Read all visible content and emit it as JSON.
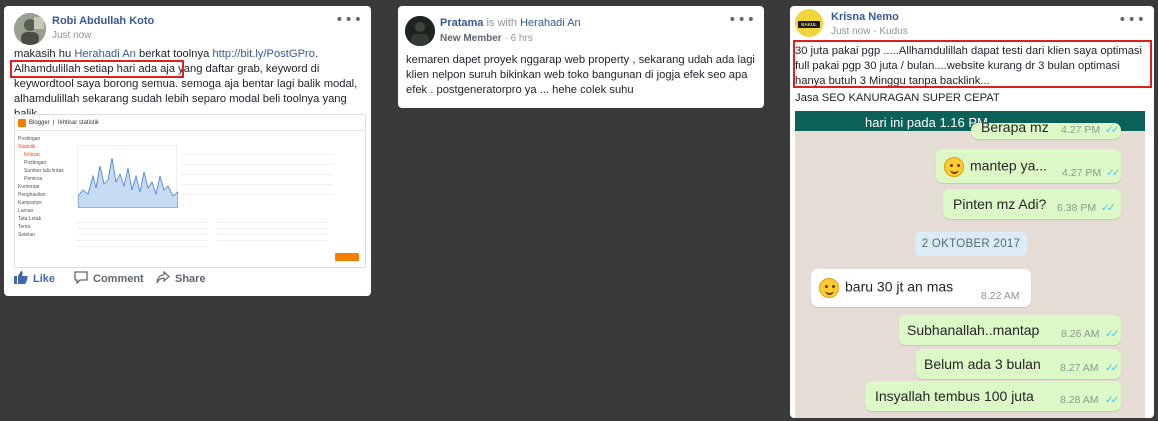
{
  "posts": [
    {
      "author": "Robi Abdullah Koto",
      "meta": "Just now",
      "text_before_link": "makasih hu ",
      "mention": "Herahadi An",
      "text_mid": " berkat toolnya ",
      "url": "http://bit.ly/PostGPro",
      "text_after": ". Alhamdulillah setiap hari ada aja yang daftar grab, keyword di keywordtool saya borong semua. semoga aja bentar lagi balik modal, alhamdulillah sekarang sudah lebih separo modal beli toolnya yang balik.",
      "screenshot": {
        "app": "Blogger",
        "section": "Ikhtisar statistik",
        "sidebar": [
          "Postingan",
          "Statistik",
          "Ikhtisar",
          "Postingan",
          "Sumber lalu lintas",
          "Pemirsa",
          "Komentar",
          "Penghasilan",
          "Kampanye",
          "Laman",
          "Tata Letak",
          "Tema",
          "Setelan"
        ]
      },
      "actions": {
        "like": "Like",
        "comment": "Comment",
        "share": "Share"
      }
    },
    {
      "author": "Pratama",
      "with_text": "is with",
      "with_name": "Herahadi An",
      "badge": "New Member",
      "meta": "6 hrs",
      "text": "kemaren dapet proyek nggarap web property , sekarang udah ada lagi klien nelpon suruh bikinkan web toko bangunan di jogja efek seo apa efek . postgeneratorpro ya ... hehe colek suhu"
    },
    {
      "author": "Krisna Nemo",
      "meta": "Just now · Kudus",
      "avatar_text": "BAKUL ORDER",
      "text_boxed": "30 juta pakai pgp .....Allhamdulillah dapat testi dari klien saya optimasi full pakai pgp 30 juta / bulan....website kurang dr 3 bulan optimasi hanya butuh 3 Minggu tanpa backlink...",
      "text_after": "Jasa SEO KANURAGAN SUPER CEPAT",
      "chat": {
        "header": "hari ini pada 1.16 PM",
        "date_separator": "2 OKTOBER 2017",
        "messages": [
          {
            "text": "Berapa mz",
            "time": "4.27 PM",
            "dir": "out"
          },
          {
            "text": "mantep ya...",
            "time": "4.27 PM",
            "dir": "out",
            "emoji": "grin"
          },
          {
            "text": "Pinten mz Adi?",
            "time": "6.38 PM",
            "dir": "out"
          },
          {
            "text": "baru 30 jt an mas",
            "time": "8.22 AM",
            "dir": "in",
            "emoji": "smile"
          },
          {
            "text": "Subhanallah..mantap",
            "time": "8.26 AM",
            "dir": "out"
          },
          {
            "text": "Belum ada 3 bulan",
            "time": "8.27 AM",
            "dir": "out"
          },
          {
            "text": "Insyallah tembus 100 juta",
            "time": "8.28 AM",
            "dir": "out"
          }
        ]
      }
    }
  ],
  "colors": {
    "background": "#3a3a3a",
    "link": "#385898",
    "highlight": "#e0201c",
    "wa_out": "#dcf8c6",
    "wa_in": "#ffffff"
  }
}
